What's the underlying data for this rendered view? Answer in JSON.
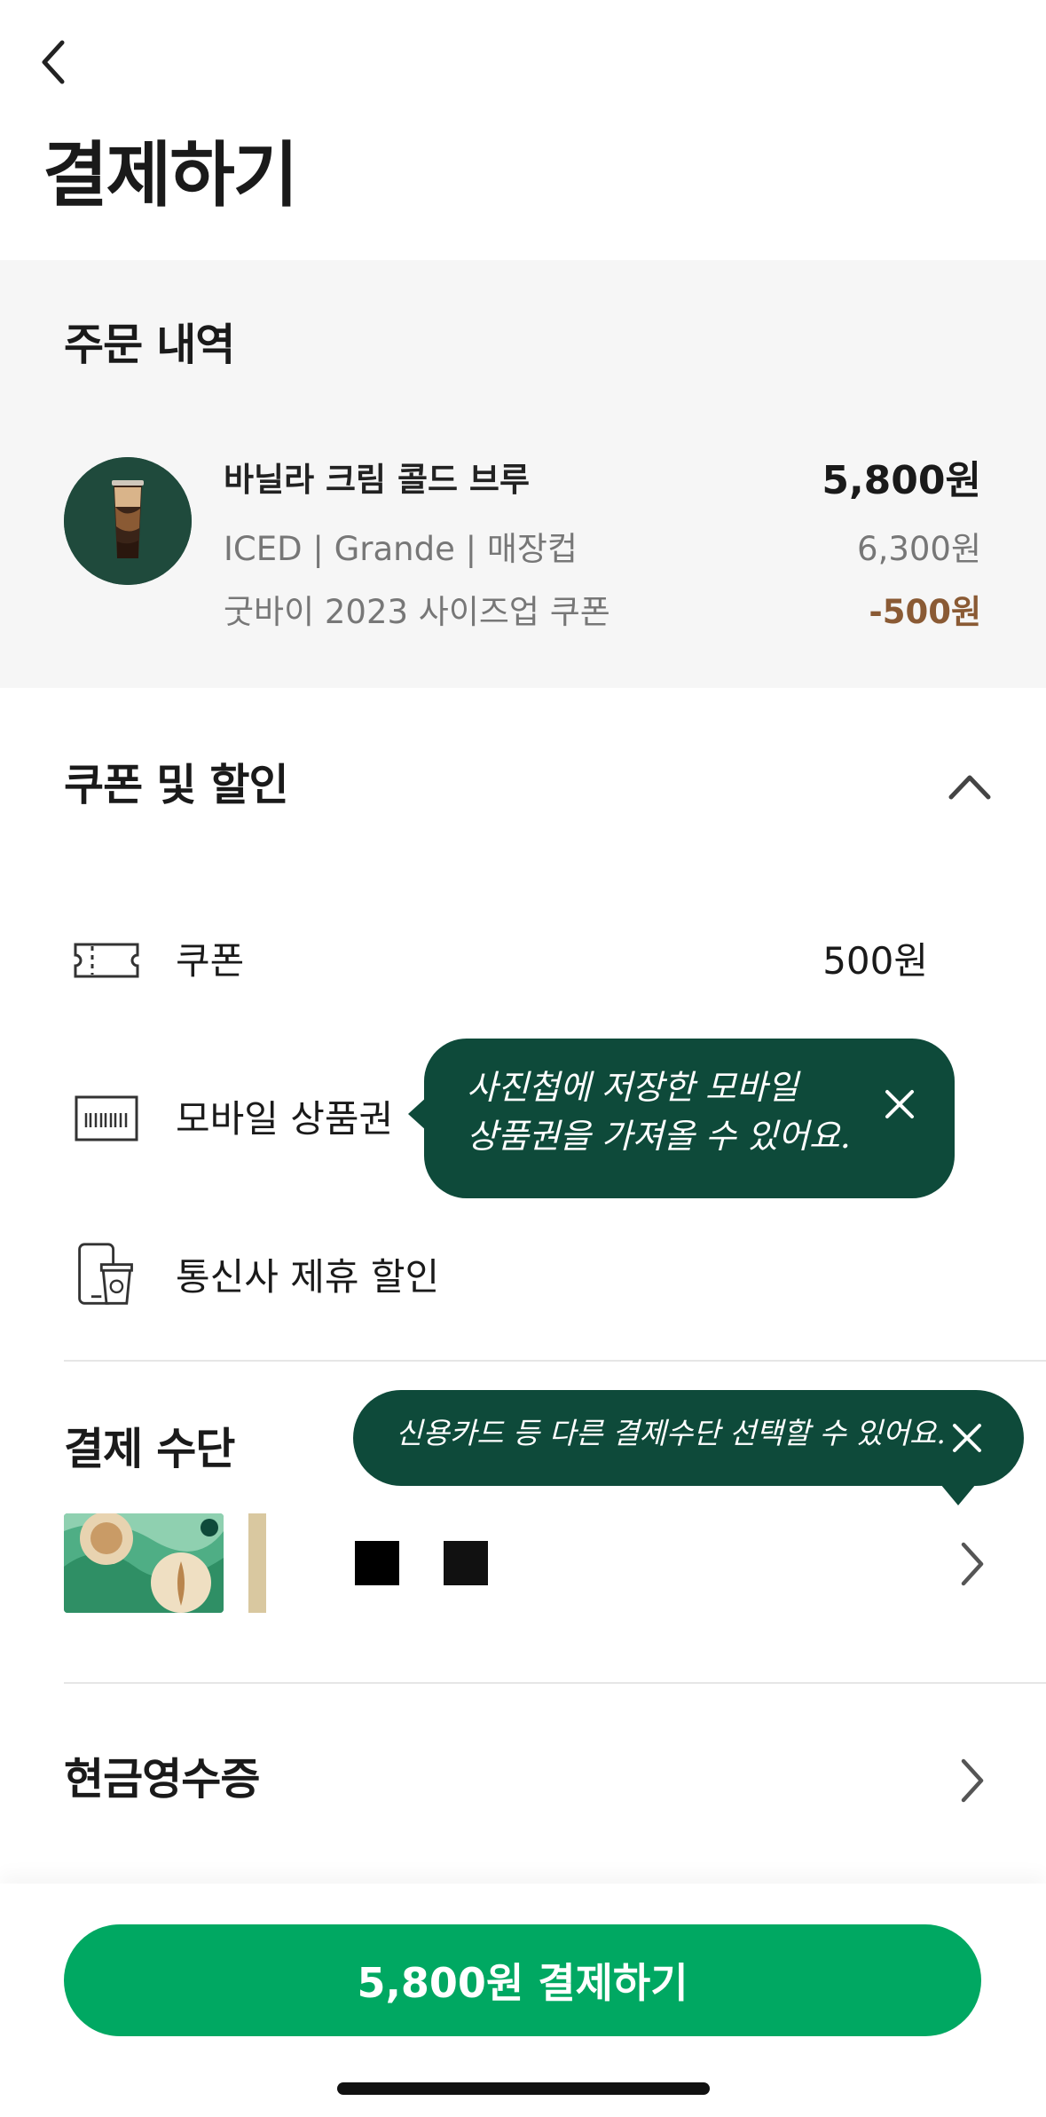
{
  "header": {
    "title": "결제하기"
  },
  "order": {
    "section_title": "주문 내역",
    "item": {
      "name": "바닐라 크림 콜드 브루",
      "options": "ICED | Grande | 매장컵",
      "coupon_name": "굿바이 2023 사이즈업 쿠폰",
      "final_price": "5,800원",
      "original_price": "6,300원",
      "discount": "-500원"
    }
  },
  "discounts": {
    "section_title": "쿠폰 및 할인",
    "coupon_label": "쿠폰",
    "coupon_value": "500원",
    "mobile_voucher_label": "모바일 상품권",
    "mobile_voucher_tooltip": "사진첩에 저장한 모바일\n상품권을 가져올 수 있어요.",
    "carrier_label": "통신사 제휴 할인"
  },
  "payment": {
    "section_title": "결제 수단",
    "tooltip": "신용카드 등 다른 결제수단 선택할 수 있어요."
  },
  "receipt": {
    "section_title": "현금영수증"
  },
  "bottom": {
    "pay_button": "5,800원 결제하기"
  },
  "colors": {
    "brand_green": "#00a862",
    "tooltip_green": "#0e4a3a",
    "discount_brown": "#8a5a34"
  },
  "icons": [
    "back-chevron-icon",
    "chevron-up-icon",
    "coupon-ticket-icon",
    "barcode-voucher-icon",
    "phone-cup-icon",
    "close-icon",
    "chevron-right-icon"
  ]
}
